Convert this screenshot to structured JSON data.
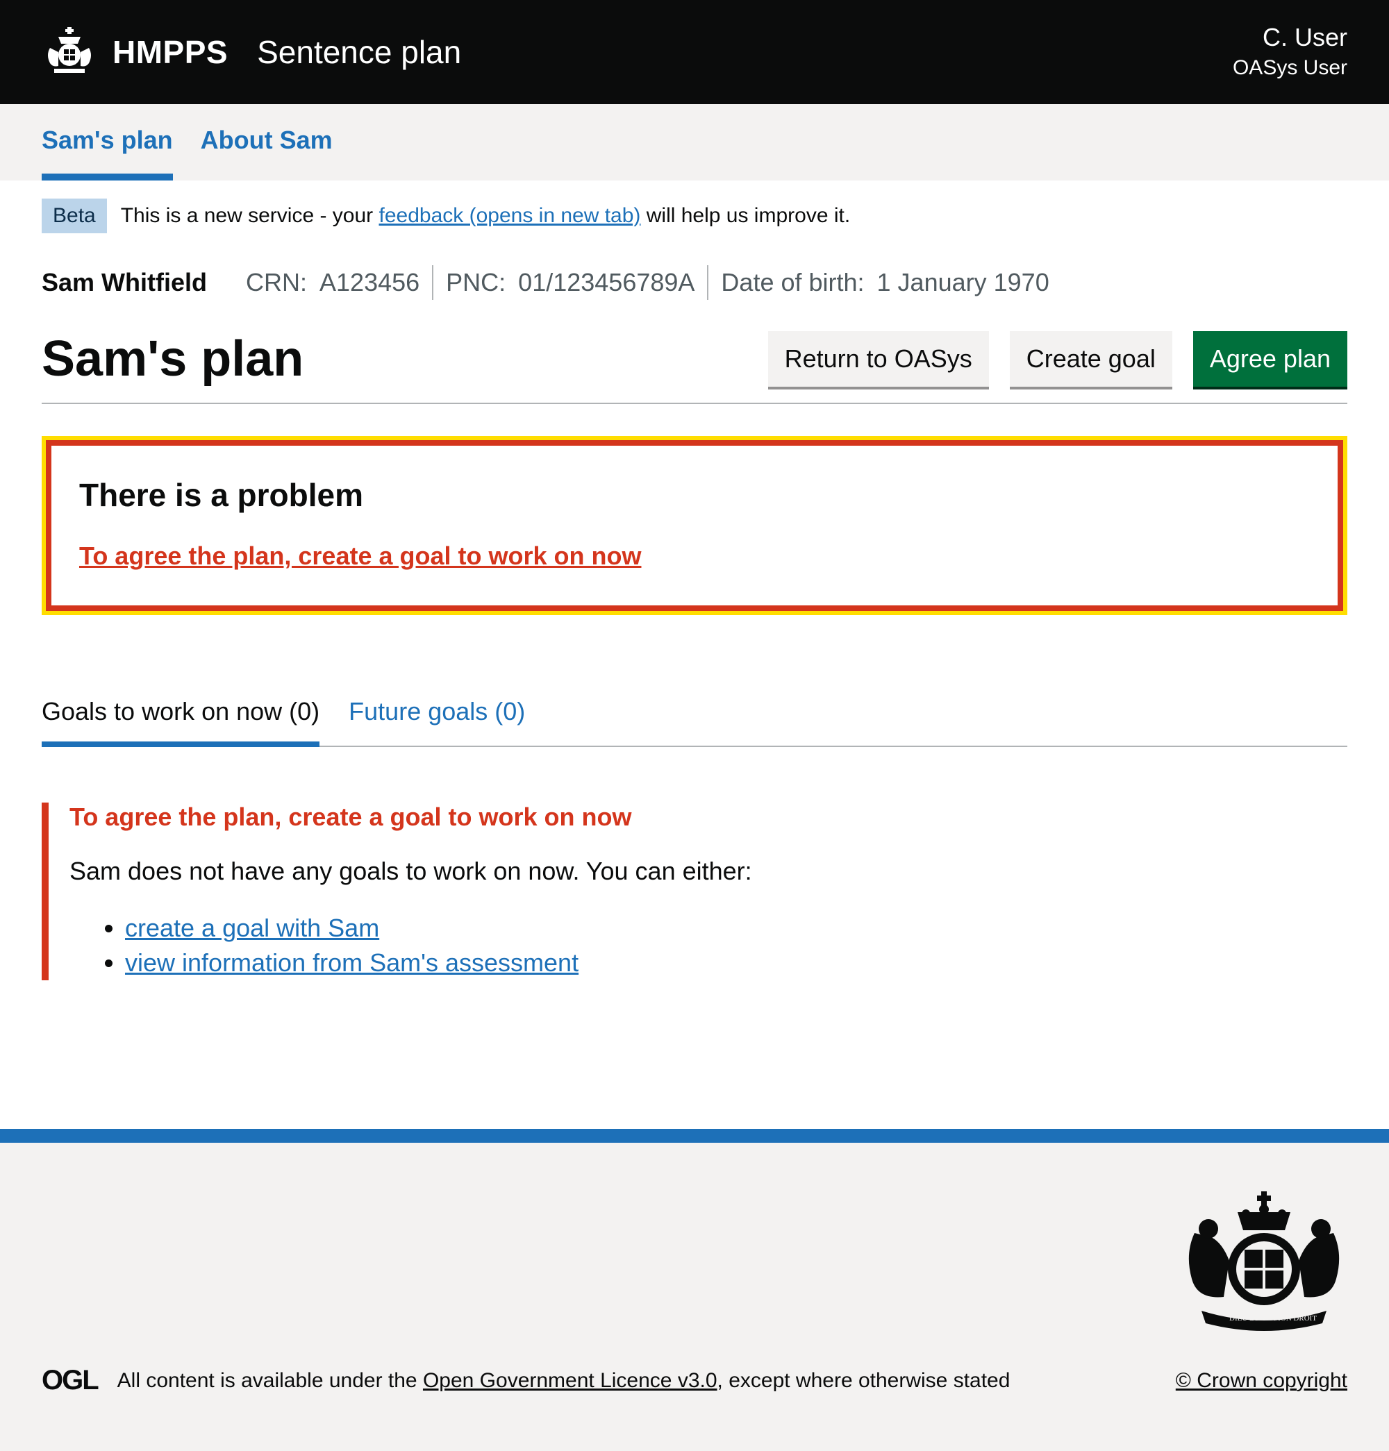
{
  "header": {
    "org": "HMPPS",
    "service": "Sentence plan",
    "user_name": "C. User",
    "user_role": "OASys User"
  },
  "primary_nav": [
    {
      "label": "Sam's plan",
      "active": true
    },
    {
      "label": "About Sam",
      "active": false
    }
  ],
  "phase": {
    "tag": "Beta",
    "text_before": "This is a new service - your ",
    "link": "feedback (opens in new tab)",
    "text_after": " will help us improve it."
  },
  "person": {
    "name": "Sam Whitfield",
    "crn_label": "CRN:",
    "crn": "A123456",
    "pnc_label": "PNC:",
    "pnc": "01/123456789A",
    "dob_label": "Date of birth:",
    "dob": "1 January 1970"
  },
  "page": {
    "title": "Sam's plan",
    "buttons": {
      "return": "Return to OASys",
      "create": "Create goal",
      "agree": "Agree plan"
    }
  },
  "error_summary": {
    "title": "There is a problem",
    "link": "To agree the plan, create a goal to work on now"
  },
  "tabs": [
    {
      "label": "Goals to work on now (0)",
      "active": true
    },
    {
      "label": "Future goals (0)",
      "active": false
    }
  ],
  "inset": {
    "title": "To agree the plan, create a goal to work on now",
    "body": "Sam does not have any goals to work on now. You can either:",
    "links": [
      "create a goal with Sam",
      "view information from Sam's assessment"
    ]
  },
  "footer": {
    "ogl_logo": "OGL",
    "licence_before": "All content is available under the ",
    "licence_link": "Open Government Licence v3.0",
    "licence_after": ", except where otherwise stated",
    "copyright": "© Crown copyright",
    "crest_motto_left": "DIEU ET",
    "crest_motto_right": "MON DROIT"
  },
  "colors": {
    "header_bg": "#0b0c0c",
    "link": "#1d70b8",
    "error": "#d4351c",
    "focus": "#ffdd00",
    "primary_button": "#00703c"
  }
}
